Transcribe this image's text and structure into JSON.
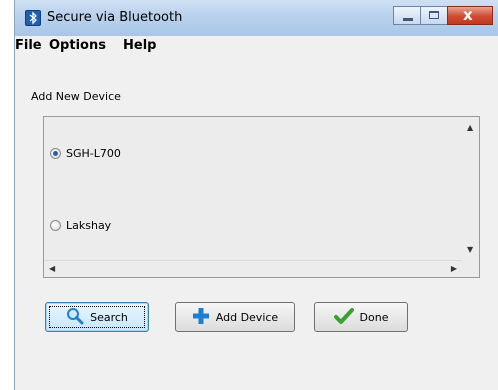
{
  "window": {
    "title": "Secure via Bluetooth",
    "controls": {
      "minimize_icon": "minimize-icon",
      "maximize_icon": "maximize-icon",
      "close_glyph": "x"
    }
  },
  "menu": {
    "items": [
      "File",
      "Options",
      "Help"
    ]
  },
  "section": {
    "label": "Add New Device"
  },
  "devices": [
    {
      "name": "SGH-L700",
      "selected": true
    },
    {
      "name": "Lakshay",
      "selected": false
    }
  ],
  "buttons": {
    "search": {
      "label": "Search",
      "icon": "search-icon"
    },
    "add_device": {
      "label": "Add Device",
      "icon": "plus-icon"
    },
    "done": {
      "label": "Done",
      "icon": "checkmark-icon"
    }
  },
  "colors": {
    "accent_blue": "#1e7fd2",
    "check_green": "#3aa02f",
    "titlebar": "#b9d1ec"
  }
}
